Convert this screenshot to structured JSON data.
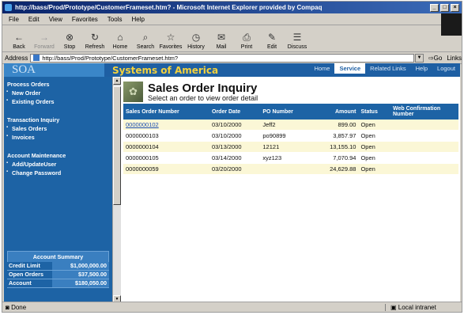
{
  "window": {
    "title": "http://bass/Prod/Prototype/CustomerFrameset.htm? - Microsoft Internet Explorer provided by Compaq"
  },
  "menu": [
    "File",
    "Edit",
    "View",
    "Favorites",
    "Tools",
    "Help"
  ],
  "toolbar": [
    {
      "label": "Back",
      "icon": "←"
    },
    {
      "label": "Forward",
      "icon": "→"
    },
    {
      "label": "Stop",
      "icon": "⊗"
    },
    {
      "label": "Refresh",
      "icon": "↻"
    },
    {
      "label": "Home",
      "icon": "⌂"
    },
    {
      "label": "Search",
      "icon": "⌕"
    },
    {
      "label": "Favorites",
      "icon": "☆"
    },
    {
      "label": "History",
      "icon": "◷"
    },
    {
      "label": "Mail",
      "icon": "✉"
    },
    {
      "label": "Print",
      "icon": "⎙"
    },
    {
      "label": "Edit",
      "icon": "✎"
    },
    {
      "label": "Discuss",
      "icon": "☰"
    }
  ],
  "address": {
    "label": "Address",
    "url": "http://bass/Prod/Prototype/CustomerFrameset.htm?",
    "go": "Go",
    "links": "Links"
  },
  "site": {
    "logo": "SOA",
    "brand": "Systems of America"
  },
  "nav": [
    "Home",
    "Service",
    "Related Links",
    "Help",
    "Logout"
  ],
  "sidebar": {
    "sections": [
      {
        "title": "Process Orders",
        "items": [
          "New Order",
          "Existing Orders"
        ]
      },
      {
        "title": "Transaction Inquiry",
        "items": [
          "Sales Orders",
          "Invoices"
        ]
      },
      {
        "title": "Account Maintenance",
        "items": [
          "Add/UpdateUser",
          "Change Password"
        ]
      }
    ],
    "summary": {
      "title": "Account Summary",
      "rows": [
        {
          "key": "Credit Limit",
          "value": "$1,000,000.00"
        },
        {
          "key": "Open Orders",
          "value": "$37,500.00"
        },
        {
          "key": "Account",
          "value": "$180,050.00"
        }
      ]
    }
  },
  "page": {
    "title": "Sales Order Inquiry",
    "subtitle": "Select an order to view order detail"
  },
  "table": {
    "columns": [
      "Sales Order Number",
      "Order Date",
      "PO Number",
      "Amount",
      "Status",
      "Web Confirmation Number"
    ],
    "rows": [
      [
        "0000000102",
        "03/10/2000",
        "Jeff2",
        "899.00",
        "Open",
        ""
      ],
      [
        "0000000103",
        "03/10/2000",
        "po90899",
        "3,857.97",
        "Open",
        ""
      ],
      [
        "0000000104",
        "03/13/2000",
        "12121",
        "13,155.10",
        "Open",
        ""
      ],
      [
        "0000000105",
        "03/14/2000",
        "xyz123",
        "7,070.94",
        "Open",
        ""
      ],
      [
        "0000000059",
        "03/20/2000",
        "",
        "24,629.88",
        "Open",
        ""
      ]
    ]
  },
  "status": {
    "left": "Done",
    "zone": "Local intranet"
  }
}
